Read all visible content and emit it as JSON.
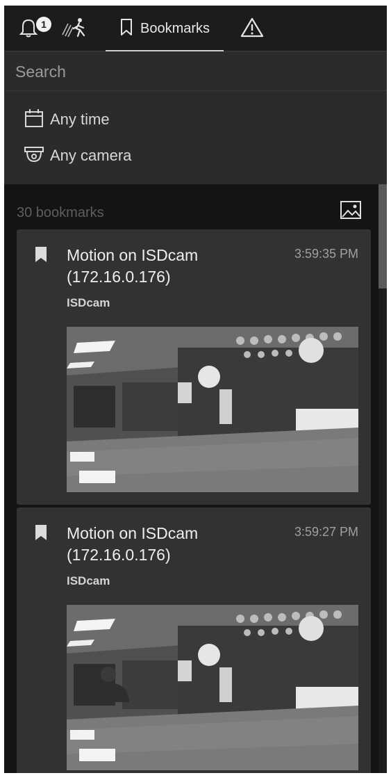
{
  "tabs": {
    "notifications": {
      "badge_count": "1",
      "icon": "bell-icon"
    },
    "motion": {
      "icon": "motion-icon"
    },
    "bookmarks": {
      "label": "Bookmarks",
      "icon": "bookmark-icon",
      "active": true
    },
    "events": {
      "icon": "warning-icon"
    }
  },
  "search": {
    "placeholder": "Search",
    "value": ""
  },
  "filters": {
    "time_label": "Any time",
    "camera_label": "Any camera"
  },
  "results": {
    "count_label": "30 bookmarks",
    "thumbnail_toggle_icon": "image-icon",
    "items": [
      {
        "title": "Motion on ISDcam (172.16.0.176)",
        "time": "3:59:35 PM",
        "camera": "ISDcam"
      },
      {
        "title": "Motion on ISDcam (172.16.0.176)",
        "time": "3:59:27 PM",
        "camera": "ISDcam"
      }
    ]
  },
  "colors": {
    "panel_background": "#2b2b2b",
    "header_background": "#1c1c1c",
    "list_background": "#141414",
    "card_background": "#323232"
  }
}
